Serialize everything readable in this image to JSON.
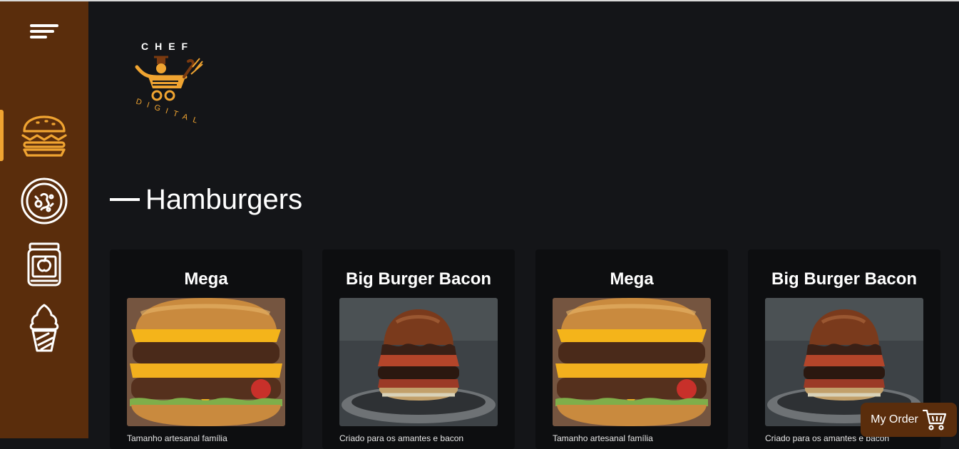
{
  "brand": {
    "logo_top": "CHEF",
    "logo_bottom": "DIGITAL",
    "accent_color": "#f0a431",
    "sidebar_color": "#5a2d0c"
  },
  "sidebar": {
    "menu_icon": "menu-icon",
    "items": [
      {
        "icon": "burger-icon",
        "active": true
      },
      {
        "icon": "pizza-icon",
        "active": false
      },
      {
        "icon": "drink-can-icon",
        "active": false
      },
      {
        "icon": "ice-cream-icon",
        "active": false
      }
    ]
  },
  "section": {
    "title": "Hamburgers"
  },
  "products": [
    {
      "name": "Mega",
      "description": "Tamanho artesanal família"
    },
    {
      "name": "Big Burger Bacon",
      "description": "Criado para os amantes e bacon"
    },
    {
      "name": "Mega",
      "description": "Tamanho artesanal família"
    },
    {
      "name": "Big Burger Bacon",
      "description": "Criado para os amantes e bacon"
    }
  ],
  "order": {
    "label": "My Order",
    "icon": "cart-icon"
  }
}
